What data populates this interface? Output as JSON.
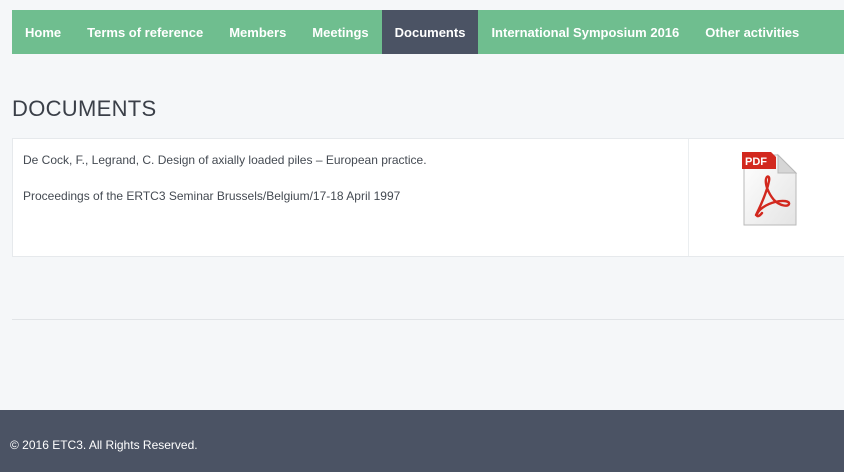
{
  "nav": {
    "items": [
      {
        "label": "Home"
      },
      {
        "label": "Terms of reference"
      },
      {
        "label": "Members"
      },
      {
        "label": "Meetings"
      },
      {
        "label": "Documents",
        "active": true
      },
      {
        "label": "International Symposium 2016"
      },
      {
        "label": "Other activities"
      }
    ]
  },
  "page": {
    "title": "DOCUMENTS"
  },
  "document": {
    "citation": "De Cock, F., Legrand, C.  Design of axially loaded piles – European practice.",
    "source": "Proceedings of the ERTC3 Seminar Brussels/Belgium/17-18 April 1997",
    "file_icon": "pdf-icon",
    "file_badge": "PDF"
  },
  "footer": {
    "copyright": "© 2016 ETC3. All Rights Reserved."
  },
  "colors": {
    "nav_bg": "#6fbe8f",
    "nav_active": "#4b5364",
    "footer_bg": "#4b5364",
    "page_bg": "#f5f7f9",
    "pdf_red": "#d2281e"
  }
}
